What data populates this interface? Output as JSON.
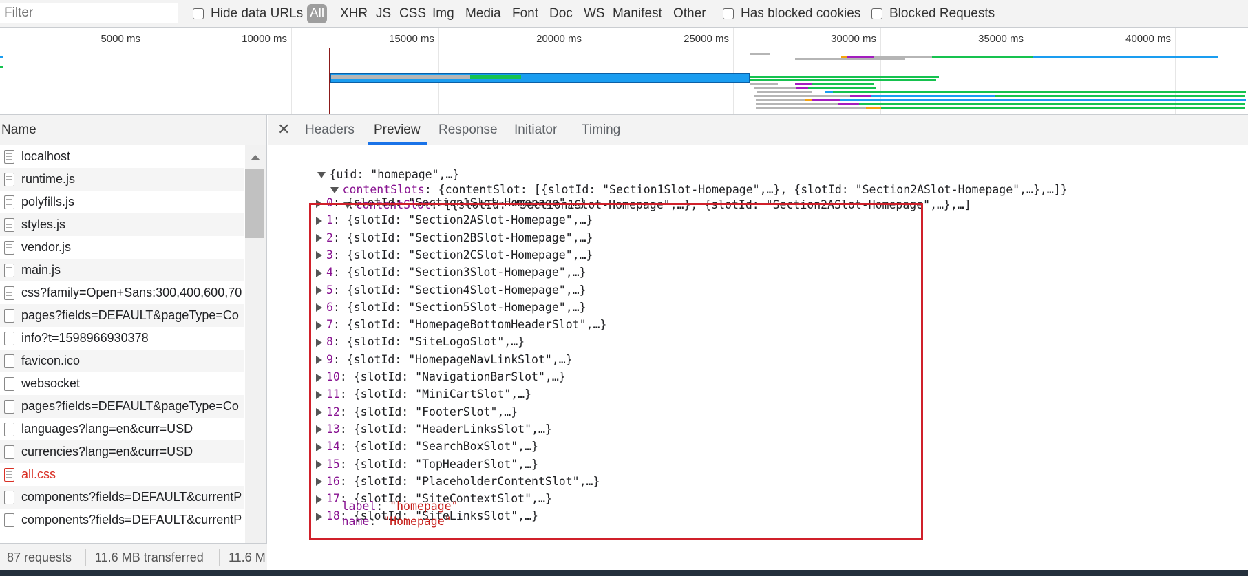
{
  "toolbar": {
    "filter_placeholder": "Filter",
    "hide_data_urls": "Hide data URLs",
    "types": [
      "All",
      "XHR",
      "JS",
      "CSS",
      "Img",
      "Media",
      "Font",
      "Doc",
      "WS",
      "Manifest",
      "Other"
    ],
    "active_type": "All",
    "has_blocked_cookies": "Has blocked cookies",
    "blocked_requests": "Blocked Requests"
  },
  "overview": {
    "ticks": [
      "5000 ms",
      "10000 ms",
      "15000 ms",
      "20000 ms",
      "25000 ms",
      "30000 ms",
      "35000 ms",
      "40000 ms"
    ]
  },
  "colors": {
    "waiting": "#b5b5b5",
    "download": "#1a9df0",
    "ssl": "#16c24f",
    "script": "#a31dbf",
    "dns": "#f4a30c",
    "highlight": "#d0202a",
    "active_tab": "#1a73e8"
  },
  "network": {
    "name_header": "Name",
    "rows": [
      {
        "name": "localhost",
        "icon": "document-icon",
        "red": false
      },
      {
        "name": "runtime.js",
        "icon": "document-icon",
        "red": false
      },
      {
        "name": "polyfills.js",
        "icon": "document-icon",
        "red": false
      },
      {
        "name": "styles.js",
        "icon": "document-icon",
        "red": false
      },
      {
        "name": "vendor.js",
        "icon": "document-icon",
        "red": false
      },
      {
        "name": "main.js",
        "icon": "document-icon",
        "red": false
      },
      {
        "name": "css?family=Open+Sans:300,400,600,70",
        "icon": "document-icon",
        "red": false
      },
      {
        "name": "pages?fields=DEFAULT&pageType=Co",
        "icon": "blank-file-icon",
        "red": false
      },
      {
        "name": "info?t=1598966930378",
        "icon": "blank-file-icon",
        "red": false
      },
      {
        "name": "favicon.ico",
        "icon": "blank-file-icon",
        "red": false
      },
      {
        "name": "websocket",
        "icon": "blank-file-icon",
        "red": false
      },
      {
        "name": "pages?fields=DEFAULT&pageType=Co",
        "icon": "blank-file-icon",
        "red": false
      },
      {
        "name": "languages?lang=en&curr=USD",
        "icon": "blank-file-icon",
        "red": false
      },
      {
        "name": "currencies?lang=en&curr=USD",
        "icon": "blank-file-icon",
        "red": false
      },
      {
        "name": "all.css",
        "icon": "document-icon",
        "red": true
      },
      {
        "name": "components?fields=DEFAULT&currentP",
        "icon": "blank-file-icon",
        "red": false
      },
      {
        "name": "components?fields=DEFAULT&currentP",
        "icon": "blank-file-icon",
        "red": false
      }
    ]
  },
  "status": {
    "requests": "87 requests",
    "transferred": "11.6 MB transferred",
    "resources": "11.6 M"
  },
  "detail": {
    "close": "✕",
    "tabs": [
      "Headers",
      "Preview",
      "Response",
      "Initiator",
      "Timing"
    ],
    "active_tab": "Preview",
    "root_summary": "{uid: \"homepage\",…}",
    "content_slots_key": "contentSlots",
    "content_slots_summary": "{contentSlot: [{slotId: \"Section1Slot-Homepage\",…}, {slotId: \"Section2ASlot-Homepage\",…},…]}",
    "content_slot_key": "contentSlot",
    "content_slot_summary": "[{slotId: \"Section1Slot-Homepage\",…}, {slotId: \"Section2ASlot-Homepage\",…},…]",
    "slots": [
      {
        "index": "0",
        "slotId": "Section1Slot-Homepage"
      },
      {
        "index": "1",
        "slotId": "Section2ASlot-Homepage"
      },
      {
        "index": "2",
        "slotId": "Section2BSlot-Homepage"
      },
      {
        "index": "3",
        "slotId": "Section2CSlot-Homepage"
      },
      {
        "index": "4",
        "slotId": "Section3Slot-Homepage"
      },
      {
        "index": "5",
        "slotId": "Section4Slot-Homepage"
      },
      {
        "index": "6",
        "slotId": "Section5Slot-Homepage"
      },
      {
        "index": "7",
        "slotId": "HomepageBottomHeaderSlot"
      },
      {
        "index": "8",
        "slotId": "SiteLogoSlot"
      },
      {
        "index": "9",
        "slotId": "HomepageNavLinkSlot"
      },
      {
        "index": "10",
        "slotId": "NavigationBarSlot"
      },
      {
        "index": "11",
        "slotId": "MiniCartSlot"
      },
      {
        "index": "12",
        "slotId": "FooterSlot"
      },
      {
        "index": "13",
        "slotId": "HeaderLinksSlot"
      },
      {
        "index": "14",
        "slotId": "SearchBoxSlot"
      },
      {
        "index": "15",
        "slotId": "TopHeaderSlot"
      },
      {
        "index": "16",
        "slotId": "PlaceholderContentSlot"
      },
      {
        "index": "17",
        "slotId": "SiteContextSlot"
      },
      {
        "index": "18",
        "slotId": "SiteLinksSlot"
      }
    ],
    "label_key": "label",
    "label_value": "\"homepage\"",
    "name_key": "name",
    "name_value": "\"Homepage\""
  }
}
